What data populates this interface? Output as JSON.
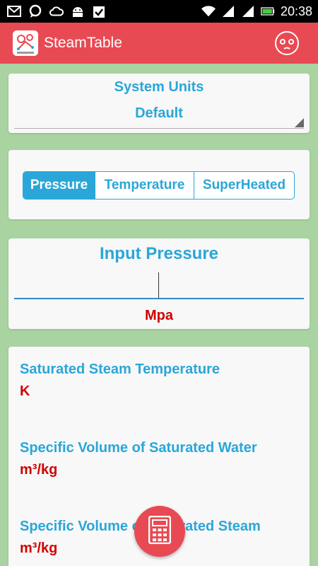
{
  "status_bar": {
    "time": "20:38",
    "left_icons": [
      "gmail-icon",
      "chat-icon",
      "cloud-icon",
      "android-icon",
      "clipboard-check-icon"
    ],
    "right_icons": [
      "wifi-icon",
      "signal-icon",
      "signal-icon",
      "battery-icon"
    ]
  },
  "app_bar": {
    "title": "SteamTable",
    "logo_icon": "steam-logo-icon",
    "action_icon": "face-icon",
    "color": "#e84a53"
  },
  "system_units": {
    "label": "System Units",
    "selected": "Default"
  },
  "tabs": [
    {
      "label": "Pressure",
      "active": true
    },
    {
      "label": "Temperature",
      "active": false
    },
    {
      "label": "SuperHeated",
      "active": false
    }
  ],
  "input": {
    "title": "Input Pressure",
    "value": "",
    "unit": "Mpa"
  },
  "results": [
    {
      "label": "Saturated Steam Temperature",
      "unit": "K"
    },
    {
      "label": "Specific Volume of Saturated Water",
      "unit": "m³/kg"
    },
    {
      "label": "Specific Volume of Saturated Steam",
      "unit": "m³/kg"
    }
  ],
  "fab": {
    "icon": "calculator-icon"
  },
  "colors": {
    "accent": "#2aa6d8",
    "unit_red": "#d10000",
    "background": "#a9d3a1"
  }
}
